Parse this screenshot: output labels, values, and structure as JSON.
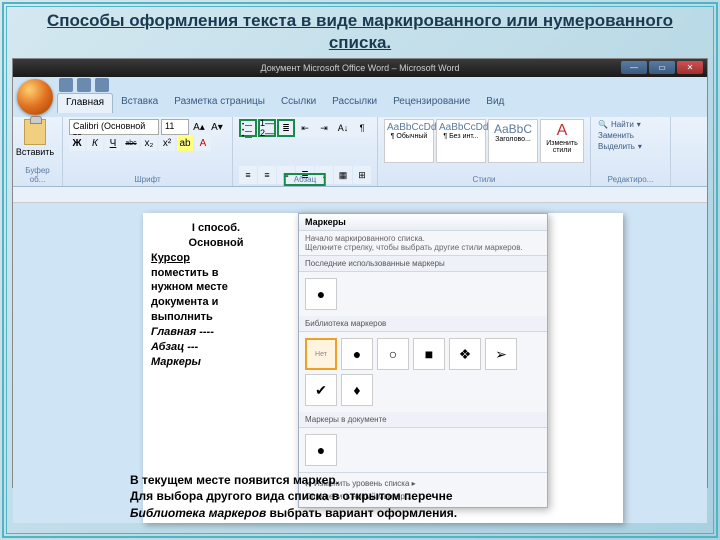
{
  "slide": {
    "title_a": "Способы оформления текста в виде  маркированного или нумерованного",
    "title_b": "списка."
  },
  "window": {
    "title": "Документ Microsoft Office Word  –  Microsoft Word",
    "min": "—",
    "max": "▭",
    "close": "✕"
  },
  "tabs": {
    "home": "Главная",
    "insert": "Вставка",
    "layout": "Разметка страницы",
    "refs": "Ссылки",
    "mail": "Рассылки",
    "review": "Рецензирование",
    "view": "Вид"
  },
  "ribbon": {
    "paste": "Вставить",
    "clipboard": "Буфер об...",
    "font_name": "Calibri (Основной те",
    "font_size": "11",
    "bold": "Ж",
    "italic": "К",
    "under": "Ч",
    "strike": "abc",
    "sub": "x₂",
    "sup": "x²",
    "font_grp": "Шрифт",
    "para_grp": "Абзац",
    "style1_p": "AaBbCcDd",
    "style1_n": "¶ Обычный",
    "style2_p": "AaBbCcDd",
    "style2_n": "¶ Без инт...",
    "style3_p": "AaBbC",
    "style3_n": "Заголово...",
    "change_styles": "Изменить стили",
    "styles_grp": "Стили",
    "find": "Найти",
    "replace": "Заменить",
    "select": "Выделить",
    "edit_grp": "Редактиро..."
  },
  "method": {
    "l1": "I  способ.",
    "l2": "Основной",
    "l3": "Курсор",
    "l4": "поместить в",
    "l5": "нужном месте",
    "l6": "документа и",
    "l7": "выполнить",
    "l8": "Главная ----",
    "l9": "Абзац  ---",
    "l10": "Маркеры"
  },
  "popup": {
    "title": "Маркеры",
    "sub1": "Начало маркированного списка.",
    "sub2": "Щелкните стрелку, чтобы выбрать другие стили маркеров.",
    "sec_recent": "Последние использованные маркеры",
    "sec_lib": "Библиотека маркеров",
    "sec_doc": "Маркеры в документе",
    "none": "Нет",
    "b_disc": "●",
    "b_circ": "○",
    "b_sq": "■",
    "b_4dia": "❖",
    "b_arrow": "➢",
    "b_check": "✔",
    "b_diamond": "♦",
    "ft1": "Изменить уровень списка",
    "ft2": "Определить новый маркер ..."
  },
  "bottom": {
    "l1": "В текущем месте появится маркер.",
    "l2a": "Для выбора другого вида списка  в открытом перечне",
    "l2b": "Библиотека маркеров",
    "l2c": " выбрать вариант оформления."
  }
}
